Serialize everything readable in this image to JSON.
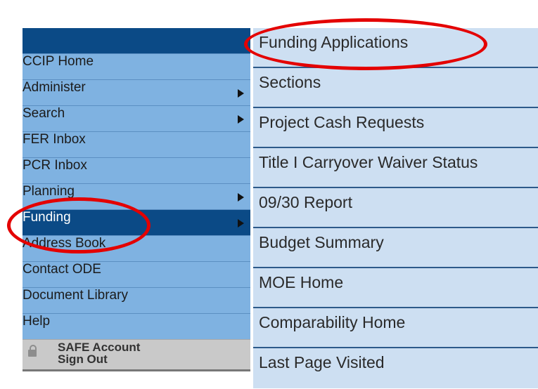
{
  "left_menu": {
    "items": [
      {
        "label": "CCIP Home",
        "has_submenu": false
      },
      {
        "label": "Administer",
        "has_submenu": true
      },
      {
        "label": "Search",
        "has_submenu": true
      },
      {
        "label": "FER Inbox",
        "has_submenu": false
      },
      {
        "label": "PCR Inbox",
        "has_submenu": false
      },
      {
        "label": "Planning",
        "has_submenu": true
      },
      {
        "label": "Funding",
        "has_submenu": true,
        "active": true
      },
      {
        "label": "Address Book",
        "has_submenu": false
      },
      {
        "label": "Contact ODE",
        "has_submenu": false
      },
      {
        "label": "Document Library",
        "has_submenu": false
      },
      {
        "label": "Help",
        "has_submenu": false
      }
    ],
    "safe_line1": "SAFE Account",
    "safe_line2": "Sign Out"
  },
  "submenu": {
    "items": [
      "Funding Applications",
      "Sections",
      "Project Cash Requests",
      "Title I Carryover Waiver Status",
      "09/30 Report",
      "Budget Summary",
      "MOE Home",
      "Comparability Home",
      "Last Page Visited"
    ]
  },
  "colors": {
    "menu_bg": "#7fb2e1",
    "menu_active": "#0b4a86",
    "submenu_bg": "#cddff2",
    "highlight": "#e40000"
  }
}
